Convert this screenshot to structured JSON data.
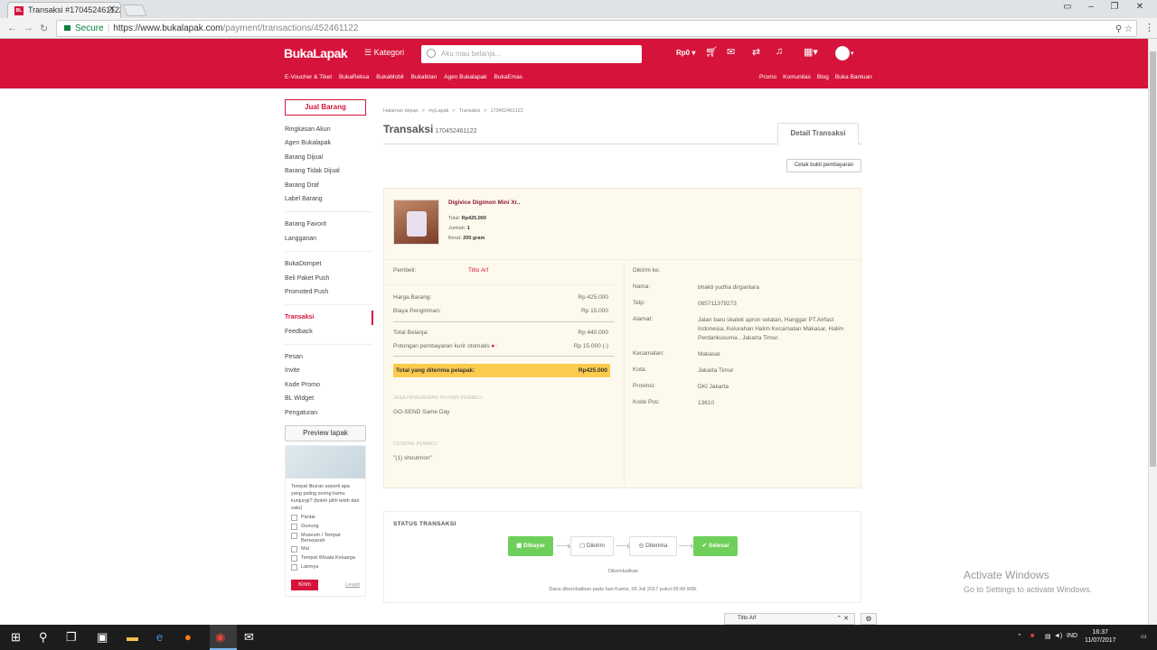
{
  "browser": {
    "tab_title": "Transaksi #170452461122",
    "tab_favicon": "BL",
    "secure_label": "Secure",
    "url_host": "https://www.bukalapak.com",
    "url_path": "/payment/transactions/452461122"
  },
  "header": {
    "logo": "BukaLapak",
    "kategori": "Kategori",
    "search_placeholder": "Aku mau belanja...",
    "balance": "Rp0",
    "subnav_left": [
      "E-Voucher & Tiket",
      "BukaReksa",
      "BukaMobil",
      "BukaIklan",
      "Agen Bukalapak",
      "BukaEmas"
    ],
    "subnav_right": [
      "Promo",
      "Komunitas",
      "Blog",
      "Buka Bantuan"
    ]
  },
  "sidebar": {
    "sell_button": "Jual Barang",
    "group1": [
      "Ringkasan Akun",
      "Agen Bukalapak",
      "Barang Dijual",
      "Barang Tidak Dijual",
      "Barang Draf",
      "Label Barang"
    ],
    "group2": [
      "Barang Favorit",
      "Langganan"
    ],
    "group3": [
      "BukaDompet",
      "Beli Paket Push",
      "Promoted Push"
    ],
    "group4": [
      "Transaksi",
      "Feedback"
    ],
    "group5": [
      "Pesan",
      "Invite",
      "Kode Promo",
      "BL Widget",
      "Pengaturan"
    ],
    "preview_button": "Preview lapak",
    "survey": {
      "question": "Tempat liburan seperti apa yang paling sering kamu kunjungi? (boleh pilih lebih dari satu)",
      "options": [
        "Pantai",
        "Gunung",
        "Museum / Tempat Bersejarah",
        "Mal",
        "Tempat Wisata Keluarga",
        "Lainnya"
      ],
      "submit": "Kirim",
      "skip": "Lewati"
    }
  },
  "main": {
    "breadcrumb": [
      "Halaman depan",
      ">",
      "myLapak",
      ">",
      "Transaksi",
      ">",
      "170452461122"
    ],
    "title": "Transaksi",
    "transaction_id": "170452461122",
    "detail_tab": "Detail Transaksi",
    "print_button": "Cetak bukti pembayaran",
    "product": {
      "name": "Digivice Digimon Mini Xr..",
      "total_label": "Total:",
      "total": "Rp425.000",
      "qty_label": "Jumlah:",
      "qty": "1",
      "weight_label": "Berat:",
      "weight": "200 gram"
    },
    "buyer_label": "Pembeli:",
    "buyer": "Titto Arf",
    "price_label": "Harga Barang:",
    "price": "Rp 425.000",
    "shipping_label": "Biaya Pengiriman:",
    "shipping": "Rp 15.000",
    "subtotal_label": "Total Belanja:",
    "subtotal": "Rp 440.000",
    "courier_cut_label": "Potongan pembayaran kurir otomatis",
    "courier_cut": "Rp 15.000 (-)",
    "received_label": "Total yang diterima pelapak:",
    "received": "Rp425.000",
    "courier_section": "JASA PENGIRIMAN PILIHAN PEMBELI",
    "courier": "GO-SEND Same Day",
    "note_section": "CATATAN PEMBELI",
    "note": "\"(1) shoutmon\"",
    "ship_to": {
      "heading": "Dikirim ke:",
      "name_label": "Nama:",
      "name": "bhakti yudha dirgantara",
      "phone_label": "Telp:",
      "phone": "085711379273",
      "address_label": "Alamat:",
      "address": "Jalan baru skatek apron selatan, Hanggar PT.Airfast Indonesia, Kelurahan Halim Kecamatan Makasar, Halim Perdankusuma , Jakarta Timur.",
      "district_label": "Kecamatan:",
      "district": "Makasar",
      "city_label": "Kota:",
      "city": "Jakarta Timur",
      "province_label": "Provinsi:",
      "province": "DKI Jakarta",
      "zip_label": "Kode Pos:",
      "zip": "13610"
    },
    "status": {
      "title": "STATUS TRANSAKSI",
      "steps": [
        "Dibayar",
        "Dikirim",
        "Diterima",
        "Selesai"
      ],
      "returned": "Dikembalikan",
      "returned_note": "Dana dikembalikan pada hari Kamis, 06 Juli 2017 pukul 09:49 WIB."
    }
  },
  "overlay": {
    "activate_title": "Activate Windows",
    "activate_sub": "Go to Settings to activate Windows.",
    "chat_name": "Titto Arf"
  },
  "taskbar": {
    "lang": "IND",
    "time": "16:37",
    "date": "11/07/2017"
  },
  "colors": {
    "brand": "#d6133b",
    "success": "#6ed05a",
    "highlight": "#fbcb4e"
  }
}
